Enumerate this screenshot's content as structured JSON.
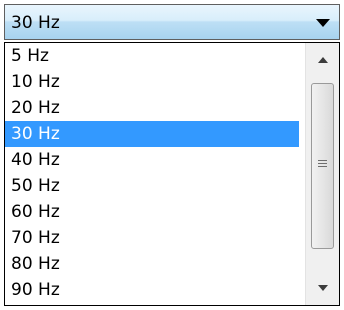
{
  "combo": {
    "value": "30 Hz"
  },
  "list": {
    "items": [
      {
        "label": "5 Hz"
      },
      {
        "label": "10 Hz"
      },
      {
        "label": "20 Hz"
      },
      {
        "label": "30 Hz"
      },
      {
        "label": "40 Hz"
      },
      {
        "label": "50 Hz"
      },
      {
        "label": "60 Hz"
      },
      {
        "label": "70 Hz"
      },
      {
        "label": "80 Hz"
      },
      {
        "label": "90 Hz"
      }
    ],
    "selected_index": 3
  },
  "colors": {
    "selection": "#3399ff",
    "selection_text": "#ffffff"
  }
}
